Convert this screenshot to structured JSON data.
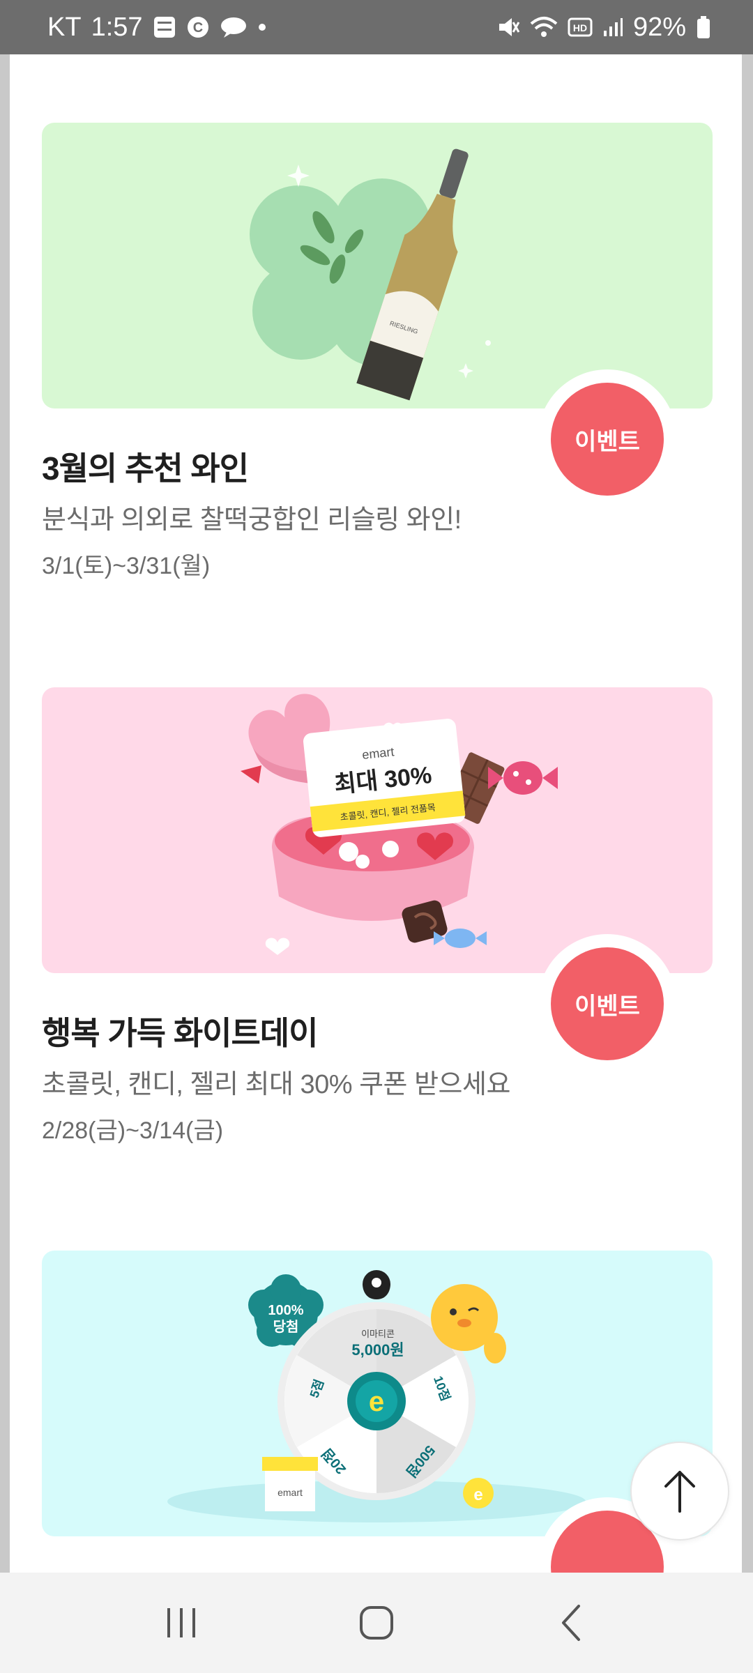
{
  "status_bar": {
    "carrier": "KT",
    "time": "1:57",
    "battery": "92%"
  },
  "cards": [
    {
      "title": "3월의 추천 와인",
      "subtitle": "분식과 의외로 찰떡궁합인 리슬링 와인!",
      "date": "3/1(토)~3/31(월)",
      "badge": "이벤트",
      "banner_color": "#d8f8d3",
      "bottle_label": "RIESLING"
    },
    {
      "title": "행복 가득 화이트데이",
      "subtitle": "초콜릿, 캔디, 젤리 최대 30% 쿠폰 받으세요",
      "date": "2/28(금)~3/14(금)",
      "badge": "이벤트",
      "banner_color": "#ffd9e8",
      "ticket_brand": "emart",
      "ticket_main": "최대 30%",
      "ticket_sub": "초콜릿, 캔디, 젤리 전품목"
    },
    {
      "banner_color": "#d6fbfb",
      "burst_text_1": "100%",
      "burst_text_2": "당첨",
      "wheel_top_label": "이마티콘",
      "wheel_top_value": "5,000원",
      "wheel_center": "e",
      "wheel_segments": [
        "10점",
        "500점",
        "20점",
        "5점"
      ],
      "box_brand": "emart",
      "coin_letter": "e"
    }
  ],
  "colors": {
    "accent": "#f25f67",
    "title": "#1f1f1f",
    "muted": "#6b6b6b"
  },
  "icons": {
    "scroll_top": "arrow-up-icon",
    "nav_recent": "recent-apps-icon",
    "nav_home": "home-icon",
    "nav_back": "back-icon"
  }
}
